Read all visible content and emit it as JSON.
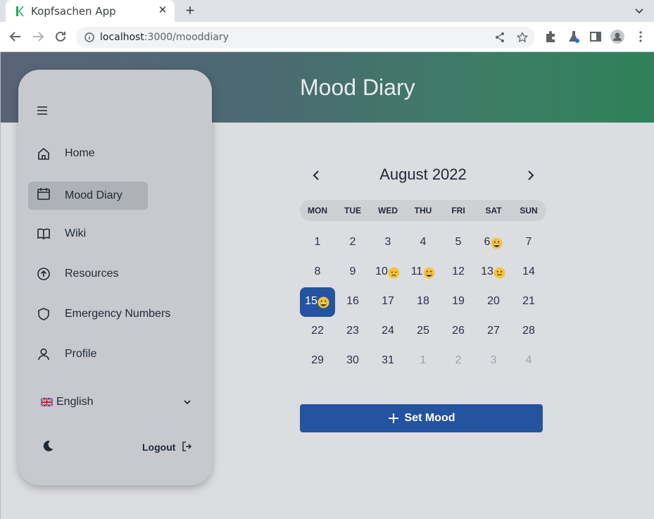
{
  "browser": {
    "tab_title": "Kopfsachen App",
    "url_host": "localhost",
    "url_path": ":3000/mooddiary"
  },
  "page": {
    "title": "Mood Diary"
  },
  "sidebar": {
    "items": [
      {
        "label": "Home",
        "icon": "home-icon"
      },
      {
        "label": "Mood Diary",
        "icon": "calendar-icon",
        "active": true
      },
      {
        "label": "Wiki",
        "icon": "book-icon"
      },
      {
        "label": "Resources",
        "icon": "arrow-up-circle-icon"
      },
      {
        "label": "Emergency Numbers",
        "icon": "shield-icon"
      },
      {
        "label": "Profile",
        "icon": "user-icon"
      }
    ],
    "language": "English",
    "logout_label": "Logout"
  },
  "calendar": {
    "month_label": "August 2022",
    "weekdays": [
      "MON",
      "TUE",
      "WED",
      "THU",
      "FRI",
      "SAT",
      "SUN"
    ],
    "weeks": [
      [
        {
          "d": "1"
        },
        {
          "d": "2"
        },
        {
          "d": "3"
        },
        {
          "d": "4"
        },
        {
          "d": "5"
        },
        {
          "d": "6",
          "mood": "grin"
        },
        {
          "d": "7"
        }
      ],
      [
        {
          "d": "8"
        },
        {
          "d": "9"
        },
        {
          "d": "10",
          "mood": "sad"
        },
        {
          "d": "11",
          "mood": "grin"
        },
        {
          "d": "12"
        },
        {
          "d": "13",
          "mood": "neutral"
        },
        {
          "d": "14"
        }
      ],
      [
        {
          "d": "15",
          "mood": "grin",
          "selected": true
        },
        {
          "d": "16"
        },
        {
          "d": "17"
        },
        {
          "d": "18"
        },
        {
          "d": "19"
        },
        {
          "d": "20"
        },
        {
          "d": "21"
        }
      ],
      [
        {
          "d": "22"
        },
        {
          "d": "23"
        },
        {
          "d": "24"
        },
        {
          "d": "25"
        },
        {
          "d": "26"
        },
        {
          "d": "27"
        },
        {
          "d": "28"
        }
      ],
      [
        {
          "d": "29"
        },
        {
          "d": "30"
        },
        {
          "d": "31"
        },
        {
          "d": "1",
          "other": true
        },
        {
          "d": "2",
          "other": true
        },
        {
          "d": "3",
          "other": true
        },
        {
          "d": "4",
          "other": true
        }
      ]
    ]
  },
  "set_mood_label": "Set Mood",
  "colors": {
    "accent": "#2453a0",
    "sidebar_bg": "#c8c9ce",
    "page_bg": "#dcdde0"
  }
}
